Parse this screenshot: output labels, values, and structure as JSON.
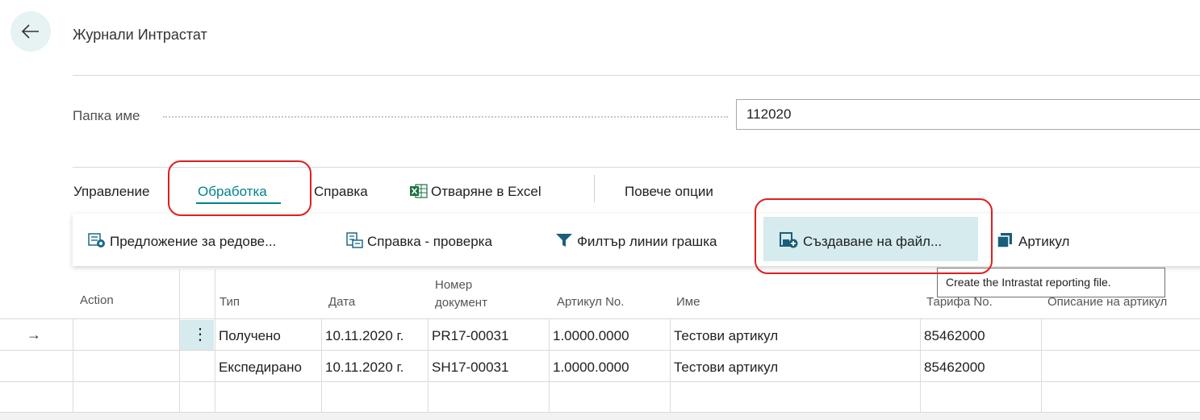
{
  "page": {
    "title": "Журнали Интрастат"
  },
  "field": {
    "label": "Папка име",
    "value": "112020"
  },
  "menu": {
    "tabs": [
      {
        "label": "Управление"
      },
      {
        "label": "Обработка",
        "active": true
      },
      {
        "label": "Справка"
      },
      {
        "label": "Отваряне в Excel",
        "icon": "excel-icon"
      },
      {
        "label": "Повече опции"
      }
    ]
  },
  "actions": [
    {
      "label": "Предложение за редове...",
      "icon": "suggest-lines-icon"
    },
    {
      "label": "Справка - проверка",
      "icon": "checklist-report-icon"
    },
    {
      "label": "Филтър линии грашка",
      "icon": "filter-icon"
    },
    {
      "label": "Създаване на файл...",
      "icon": "create-file-icon",
      "highlighted": true
    },
    {
      "label": "Артикул",
      "icon": "item-icon"
    }
  ],
  "tooltip": "Create the Intrastat reporting file.",
  "table": {
    "columns": [
      "Action",
      "Тип",
      "Дата",
      "Номер документ",
      "Артикул No.",
      "Име",
      "Тарифа No.",
      "Описание на артикул"
    ],
    "column_lines": [
      "Номер",
      "документ"
    ],
    "rows": [
      {
        "type": "Получено",
        "date": "10.11.2020 г.",
        "doc": "PR17-00031",
        "item": "1.0000.0000",
        "name": "Тестови артикул",
        "tariff": "85462000",
        "desc": ""
      },
      {
        "type": "Експедирано",
        "date": "10.11.2020 г.",
        "doc": "SH17-00031",
        "item": "1.0000.0000",
        "name": "Тестови артикул",
        "tariff": "85462000",
        "desc": ""
      }
    ],
    "row_menu_symbol": "⋮",
    "current_row_indicator": "→"
  },
  "colors": {
    "accent": "#00838f",
    "highlight": "#d5ebed",
    "annotation": "#e01e1e",
    "excel": "#1d7044"
  }
}
